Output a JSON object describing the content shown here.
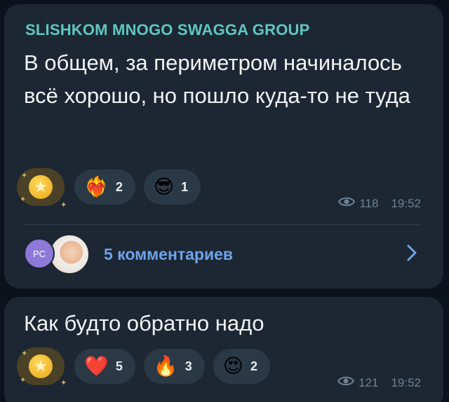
{
  "posts": [
    {
      "author": "SLISHKOM MNOGO SWAGGA GROUP",
      "text": "В общем, за периметром начиналось всё хорошо, но пошло куда-то не туда",
      "reactions": [
        {
          "emoji": "❤️‍🔥",
          "icon": "heart-on-fire-icon",
          "count": "2"
        },
        {
          "emoji": "😎",
          "icon": "sunglasses-face-icon",
          "count": "1"
        }
      ],
      "views": "118",
      "time": "19:52",
      "comments": {
        "avatar_initials": "PC",
        "label": "5 комментариев"
      }
    },
    {
      "text": "Как будто обратно надо",
      "reactions": [
        {
          "emoji": "❤️",
          "icon": "red-heart-icon",
          "count": "5"
        },
        {
          "emoji": "🔥",
          "icon": "fire-icon",
          "count": "3"
        },
        {
          "emoji": "😍",
          "icon": "heart-eyes-face-icon",
          "count": "2"
        }
      ],
      "views": "121",
      "time": "19:52"
    }
  ],
  "colors": {
    "background": "#0b121b",
    "bubble": "#1c2733",
    "author": "#5fc7c2",
    "link": "#6fa3e8",
    "meta": "#6f8294"
  }
}
